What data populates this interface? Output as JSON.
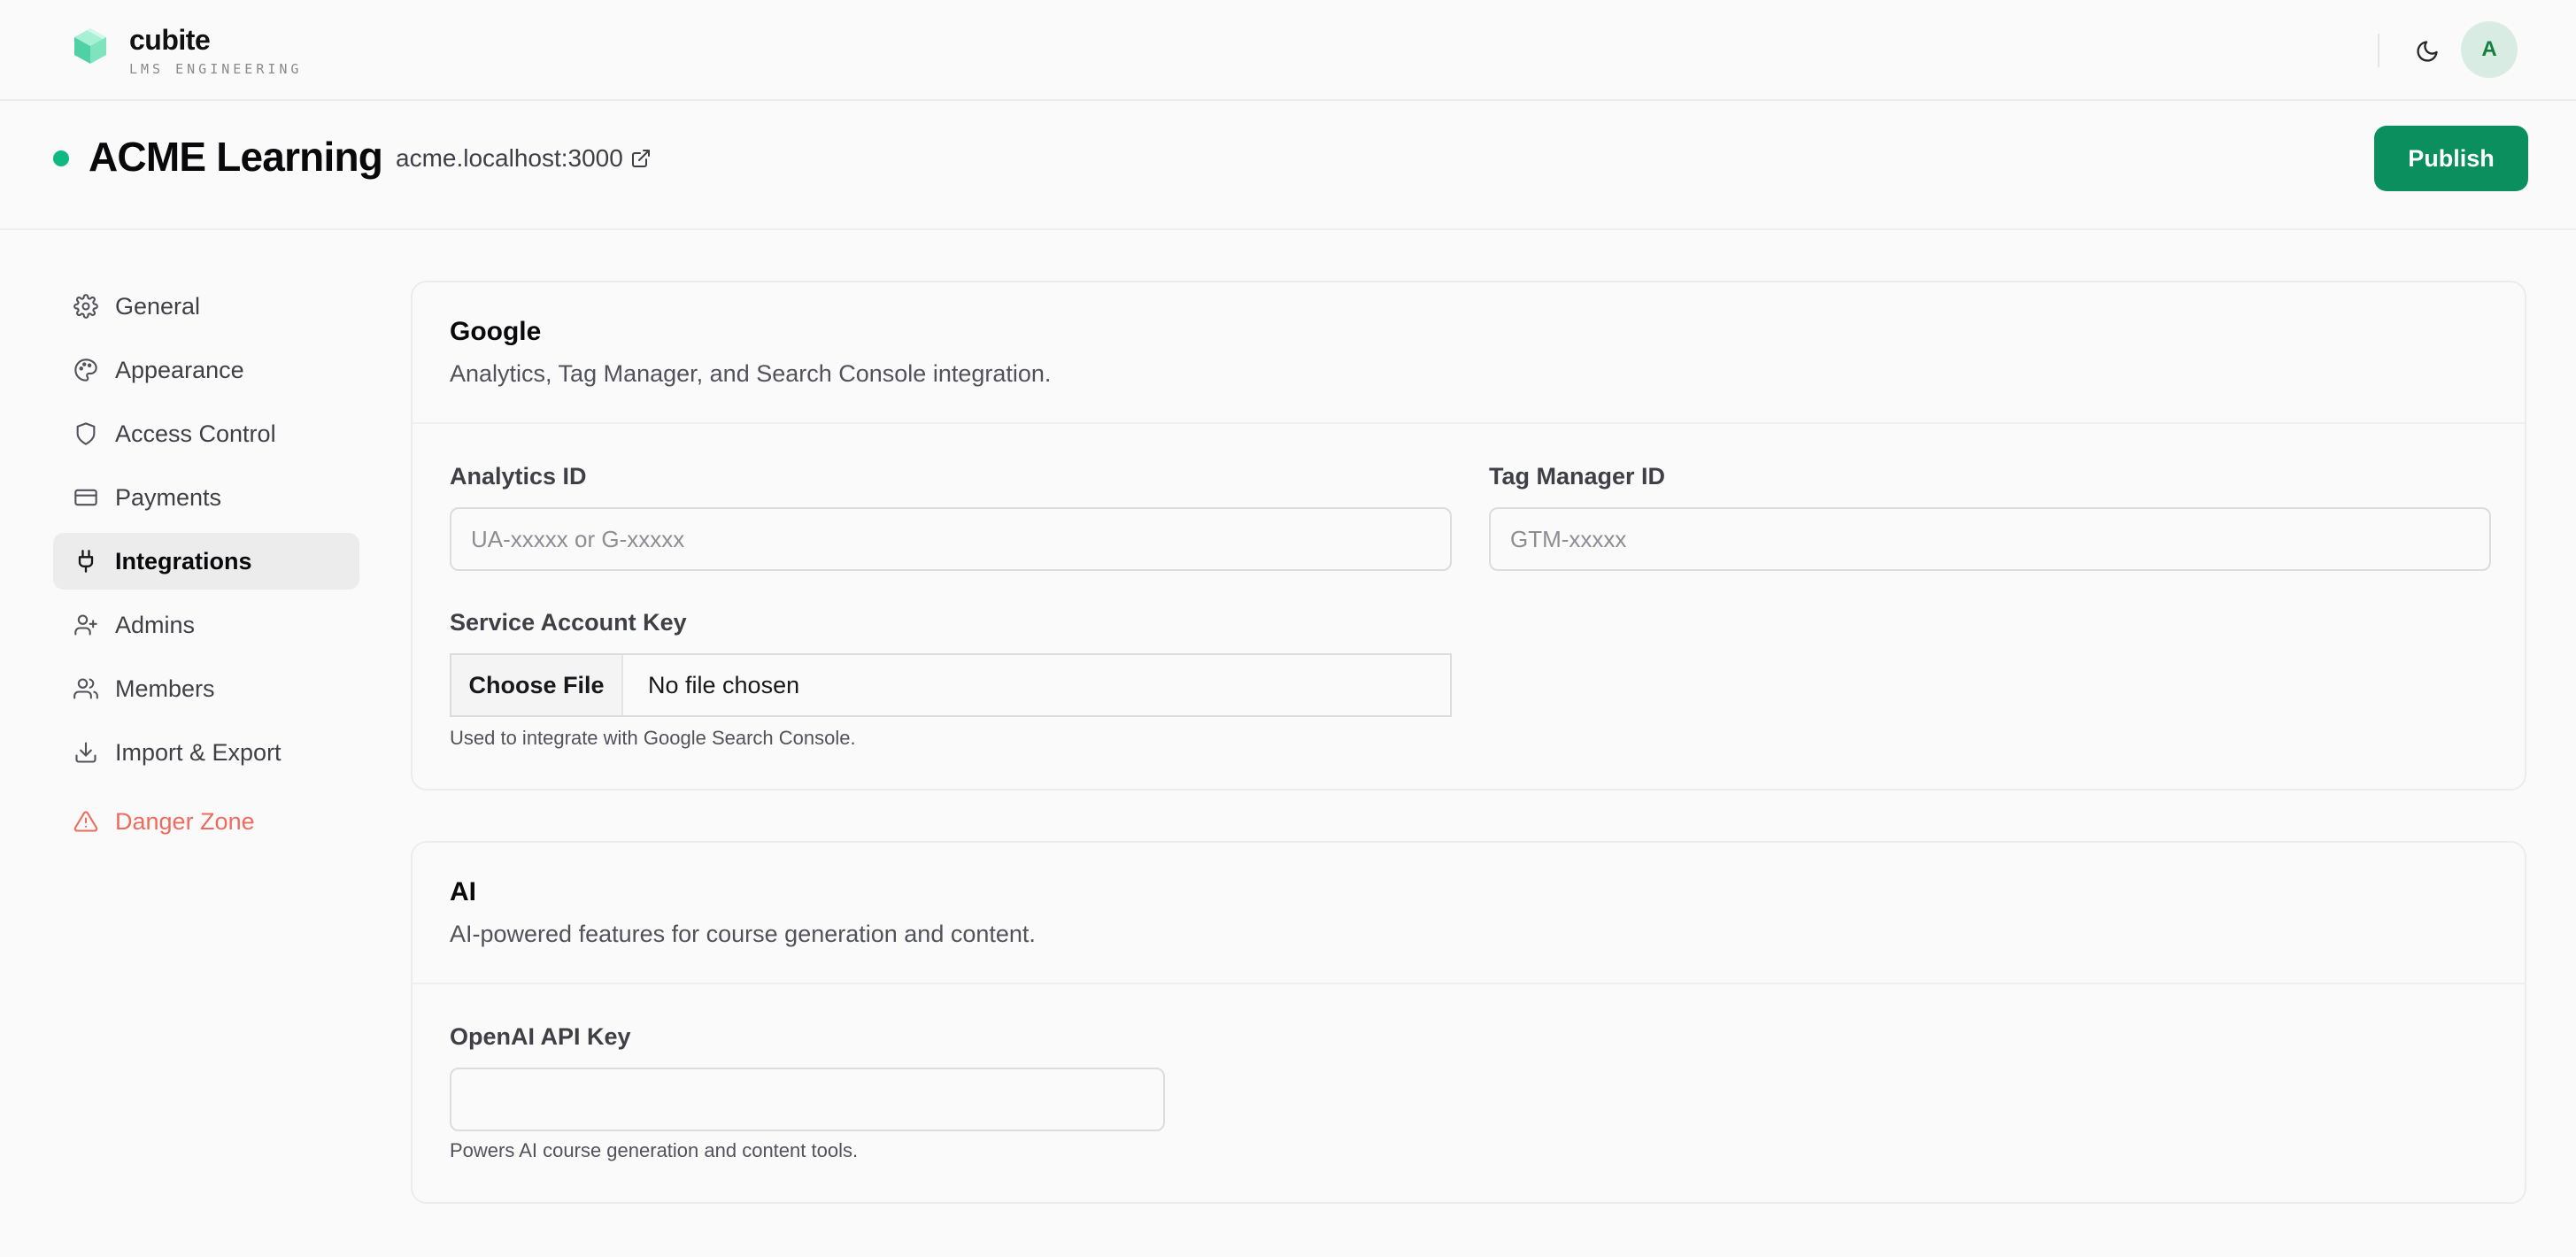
{
  "brand": {
    "name": "cubite",
    "subtitle": "LMS ENGINEERING",
    "logo_icon": "cube-icon",
    "accent": "#4fd1a5"
  },
  "topbar": {
    "theme_toggle_icon": "moon-icon",
    "avatar_initial": "A"
  },
  "site": {
    "status": "online",
    "status_color": "#10b981",
    "title": "ACME Learning",
    "url": "acme.localhost:3000",
    "publish_label": "Publish",
    "publish_color": "#0c8f5e"
  },
  "sidebar": {
    "items": [
      {
        "label": "General",
        "icon": "gear-icon"
      },
      {
        "label": "Appearance",
        "icon": "palette-icon"
      },
      {
        "label": "Access Control",
        "icon": "shield-icon"
      },
      {
        "label": "Payments",
        "icon": "credit-card-icon"
      },
      {
        "label": "Integrations",
        "icon": "plug-icon",
        "active": true
      },
      {
        "label": "Admins",
        "icon": "user-plus-icon"
      },
      {
        "label": "Members",
        "icon": "users-icon"
      },
      {
        "label": "Import & Export",
        "icon": "download-icon"
      }
    ],
    "danger": {
      "label": "Danger Zone",
      "icon": "warning-triangle-icon",
      "color": "#ef6b5e"
    }
  },
  "google": {
    "title": "Google",
    "description": "Analytics, Tag Manager, and Search Console integration.",
    "analytics": {
      "label": "Analytics ID",
      "value": "",
      "placeholder": "UA-xxxxx or G-xxxxx"
    },
    "tag_manager": {
      "label": "Tag Manager ID",
      "value": "",
      "placeholder": "GTM-xxxxx"
    },
    "service_account": {
      "label": "Service Account Key",
      "button": "Choose File",
      "status": "No file chosen",
      "help": "Used to integrate with Google Search Console."
    }
  },
  "ai": {
    "title": "AI",
    "description": "AI-powered features for course generation and content.",
    "openai": {
      "label": "OpenAI API Key",
      "value": "",
      "help": "Powers AI course generation and content tools."
    }
  }
}
